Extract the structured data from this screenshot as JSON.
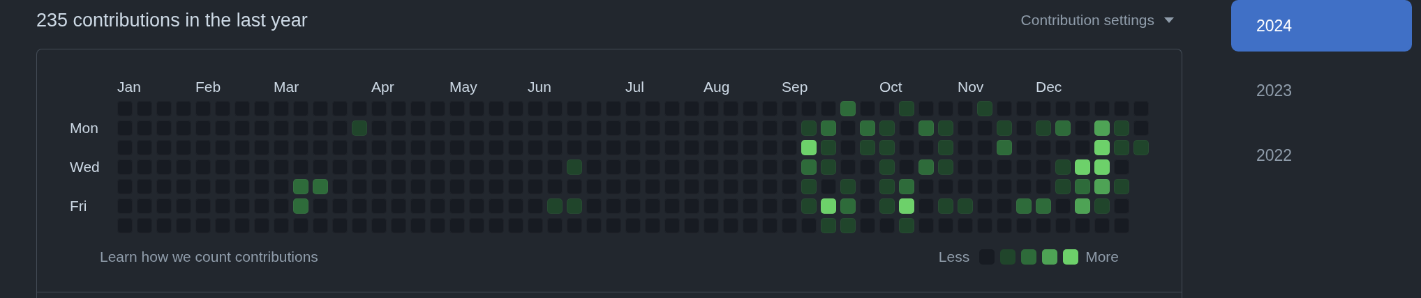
{
  "title": "235 contributions in the last year",
  "settings": {
    "label": "Contribution settings"
  },
  "weekday_labels": [
    "Mon",
    "Wed",
    "Fri"
  ],
  "weeks": [
    {
      "month": "Jan",
      "days": [
        {
          "color": "#171b22"
        },
        {
          "color": "#171b22"
        },
        {
          "color": "#171b22"
        },
        {
          "color": "#171b22"
        },
        {
          "color": "#171b22"
        },
        {
          "color": "#171b22"
        },
        {
          "color": "#171b22"
        }
      ]
    },
    {
      "days": [
        {
          "color": "#171b22"
        },
        {
          "color": "#171b22"
        },
        {
          "color": "#171b22"
        },
        {
          "color": "#171b22"
        },
        {
          "color": "#171b22"
        },
        {
          "color": "#171b22"
        },
        {
          "color": "#171b22"
        }
      ]
    },
    {
      "days": [
        {
          "color": "#171b22"
        },
        {
          "color": "#171b22"
        },
        {
          "color": "#171b22"
        },
        {
          "color": "#171b22"
        },
        {
          "color": "#171b22"
        },
        {
          "color": "#171b22"
        },
        {
          "color": "#171b22"
        }
      ]
    },
    {
      "days": [
        {
          "color": "#171b22"
        },
        {
          "color": "#171b22"
        },
        {
          "color": "#171b22"
        },
        {
          "color": "#171b22"
        },
        {
          "color": "#171b22"
        },
        {
          "color": "#171b22"
        },
        {
          "color": "#171b22"
        }
      ]
    },
    {
      "month": "Feb",
      "days": [
        {
          "color": "#171b22"
        },
        {
          "color": "#171b22"
        },
        {
          "color": "#171b22"
        },
        {
          "color": "#171b22"
        },
        {
          "color": "#171b22"
        },
        {
          "color": "#171b22"
        },
        {
          "color": "#171b22"
        }
      ]
    },
    {
      "days": [
        {
          "color": "#171b22"
        },
        {
          "color": "#171b22"
        },
        {
          "color": "#171b22"
        },
        {
          "color": "#171b22"
        },
        {
          "color": "#171b22"
        },
        {
          "color": "#171b22"
        },
        {
          "color": "#171b22"
        }
      ]
    },
    {
      "days": [
        {
          "color": "#171b22"
        },
        {
          "color": "#171b22"
        },
        {
          "color": "#171b22"
        },
        {
          "color": "#171b22"
        },
        {
          "color": "#171b22"
        },
        {
          "color": "#171b22"
        },
        {
          "color": "#171b22"
        }
      ]
    },
    {
      "days": [
        {
          "color": "#171b22"
        },
        {
          "color": "#171b22"
        },
        {
          "color": "#171b22"
        },
        {
          "color": "#171b22"
        },
        {
          "color": "#171b22"
        },
        {
          "color": "#171b22"
        },
        {
          "color": "#171b22"
        }
      ]
    },
    {
      "month": "Mar",
      "days": [
        {
          "color": "#171b22"
        },
        {
          "color": "#171b22"
        },
        {
          "color": "#171b22"
        },
        {
          "color": "#171b22"
        },
        {
          "color": "#171b22"
        },
        {
          "color": "#171b22"
        },
        {
          "color": "#171b22"
        }
      ]
    },
    {
      "days": [
        {
          "color": "#171b22"
        },
        {
          "color": "#171b22"
        },
        {
          "color": "#171b22"
        },
        {
          "color": "#171b22"
        },
        {
          "color": "#2e6b3a"
        },
        {
          "color": "#2e6b3a"
        },
        {
          "color": "#171b22"
        }
      ]
    },
    {
      "days": [
        {
          "color": "#171b22"
        },
        {
          "color": "#171b22"
        },
        {
          "color": "#171b22"
        },
        {
          "color": "#171b22"
        },
        {
          "color": "#2e6b3a"
        },
        {
          "color": "#171b22"
        },
        {
          "color": "#171b22"
        }
      ]
    },
    {
      "days": [
        {
          "color": "#171b22"
        },
        {
          "color": "#171b22"
        },
        {
          "color": "#171b22"
        },
        {
          "color": "#171b22"
        },
        {
          "color": "#171b22"
        },
        {
          "color": "#171b22"
        },
        {
          "color": "#171b22"
        }
      ]
    },
    {
      "days": [
        {
          "color": "#171b22"
        },
        {
          "color": "#20452b"
        },
        {
          "color": "#171b22"
        },
        {
          "color": "#171b22"
        },
        {
          "color": "#171b22"
        },
        {
          "color": "#171b22"
        },
        {
          "color": "#171b22"
        }
      ]
    },
    {
      "month": "Apr",
      "days": [
        {
          "color": "#171b22"
        },
        {
          "color": "#171b22"
        },
        {
          "color": "#171b22"
        },
        {
          "color": "#171b22"
        },
        {
          "color": "#171b22"
        },
        {
          "color": "#171b22"
        },
        {
          "color": "#171b22"
        }
      ]
    },
    {
      "days": [
        {
          "color": "#171b22"
        },
        {
          "color": "#171b22"
        },
        {
          "color": "#171b22"
        },
        {
          "color": "#171b22"
        },
        {
          "color": "#171b22"
        },
        {
          "color": "#171b22"
        },
        {
          "color": "#171b22"
        }
      ]
    },
    {
      "days": [
        {
          "color": "#171b22"
        },
        {
          "color": "#171b22"
        },
        {
          "color": "#171b22"
        },
        {
          "color": "#171b22"
        },
        {
          "color": "#171b22"
        },
        {
          "color": "#171b22"
        },
        {
          "color": "#171b22"
        }
      ]
    },
    {
      "days": [
        {
          "color": "#171b22"
        },
        {
          "color": "#171b22"
        },
        {
          "color": "#171b22"
        },
        {
          "color": "#171b22"
        },
        {
          "color": "#171b22"
        },
        {
          "color": "#171b22"
        },
        {
          "color": "#171b22"
        }
      ]
    },
    {
      "month": "May",
      "days": [
        {
          "color": "#171b22"
        },
        {
          "color": "#171b22"
        },
        {
          "color": "#171b22"
        },
        {
          "color": "#171b22"
        },
        {
          "color": "#171b22"
        },
        {
          "color": "#171b22"
        },
        {
          "color": "#171b22"
        }
      ]
    },
    {
      "days": [
        {
          "color": "#171b22"
        },
        {
          "color": "#171b22"
        },
        {
          "color": "#171b22"
        },
        {
          "color": "#171b22"
        },
        {
          "color": "#171b22"
        },
        {
          "color": "#171b22"
        },
        {
          "color": "#171b22"
        }
      ]
    },
    {
      "days": [
        {
          "color": "#171b22"
        },
        {
          "color": "#171b22"
        },
        {
          "color": "#171b22"
        },
        {
          "color": "#171b22"
        },
        {
          "color": "#171b22"
        },
        {
          "color": "#171b22"
        },
        {
          "color": "#171b22"
        }
      ]
    },
    {
      "days": [
        {
          "color": "#171b22"
        },
        {
          "color": "#171b22"
        },
        {
          "color": "#171b22"
        },
        {
          "color": "#171b22"
        },
        {
          "color": "#171b22"
        },
        {
          "color": "#171b22"
        },
        {
          "color": "#171b22"
        }
      ]
    },
    {
      "month": "Jun",
      "days": [
        {
          "color": "#171b22"
        },
        {
          "color": "#171b22"
        },
        {
          "color": "#171b22"
        },
        {
          "color": "#171b22"
        },
        {
          "color": "#171b22"
        },
        {
          "color": "#171b22"
        },
        {
          "color": "#171b22"
        }
      ]
    },
    {
      "days": [
        {
          "color": "#171b22"
        },
        {
          "color": "#171b22"
        },
        {
          "color": "#171b22"
        },
        {
          "color": "#171b22"
        },
        {
          "color": "#171b22"
        },
        {
          "color": "#20452b"
        },
        {
          "color": "#171b22"
        }
      ]
    },
    {
      "days": [
        {
          "color": "#171b22"
        },
        {
          "color": "#171b22"
        },
        {
          "color": "#171b22"
        },
        {
          "color": "#20452b"
        },
        {
          "color": "#171b22"
        },
        {
          "color": "#20452b"
        },
        {
          "color": "#171b22"
        }
      ]
    },
    {
      "days": [
        {
          "color": "#171b22"
        },
        {
          "color": "#171b22"
        },
        {
          "color": "#171b22"
        },
        {
          "color": "#171b22"
        },
        {
          "color": "#171b22"
        },
        {
          "color": "#171b22"
        },
        {
          "color": "#171b22"
        }
      ]
    },
    {
      "days": [
        {
          "color": "#171b22"
        },
        {
          "color": "#171b22"
        },
        {
          "color": "#171b22"
        },
        {
          "color": "#171b22"
        },
        {
          "color": "#171b22"
        },
        {
          "color": "#171b22"
        },
        {
          "color": "#171b22"
        }
      ]
    },
    {
      "month": "Jul",
      "days": [
        {
          "color": "#171b22"
        },
        {
          "color": "#171b22"
        },
        {
          "color": "#171b22"
        },
        {
          "color": "#171b22"
        },
        {
          "color": "#171b22"
        },
        {
          "color": "#171b22"
        },
        {
          "color": "#171b22"
        }
      ]
    },
    {
      "days": [
        {
          "color": "#171b22"
        },
        {
          "color": "#171b22"
        },
        {
          "color": "#171b22"
        },
        {
          "color": "#171b22"
        },
        {
          "color": "#171b22"
        },
        {
          "color": "#171b22"
        },
        {
          "color": "#171b22"
        }
      ]
    },
    {
      "days": [
        {
          "color": "#171b22"
        },
        {
          "color": "#171b22"
        },
        {
          "color": "#171b22"
        },
        {
          "color": "#171b22"
        },
        {
          "color": "#171b22"
        },
        {
          "color": "#171b22"
        },
        {
          "color": "#171b22"
        }
      ]
    },
    {
      "days": [
        {
          "color": "#171b22"
        },
        {
          "color": "#171b22"
        },
        {
          "color": "#171b22"
        },
        {
          "color": "#171b22"
        },
        {
          "color": "#171b22"
        },
        {
          "color": "#171b22"
        },
        {
          "color": "#171b22"
        }
      ]
    },
    {
      "month": "Aug",
      "days": [
        {
          "color": "#171b22"
        },
        {
          "color": "#171b22"
        },
        {
          "color": "#171b22"
        },
        {
          "color": "#171b22"
        },
        {
          "color": "#171b22"
        },
        {
          "color": "#171b22"
        },
        {
          "color": "#171b22"
        }
      ]
    },
    {
      "days": [
        {
          "color": "#171b22"
        },
        {
          "color": "#171b22"
        },
        {
          "color": "#171b22"
        },
        {
          "color": "#171b22"
        },
        {
          "color": "#171b22"
        },
        {
          "color": "#171b22"
        },
        {
          "color": "#171b22"
        }
      ]
    },
    {
      "days": [
        {
          "color": "#171b22"
        },
        {
          "color": "#171b22"
        },
        {
          "color": "#171b22"
        },
        {
          "color": "#171b22"
        },
        {
          "color": "#171b22"
        },
        {
          "color": "#171b22"
        },
        {
          "color": "#171b22"
        }
      ]
    },
    {
      "days": [
        {
          "color": "#171b22"
        },
        {
          "color": "#171b22"
        },
        {
          "color": "#171b22"
        },
        {
          "color": "#171b22"
        },
        {
          "color": "#171b22"
        },
        {
          "color": "#171b22"
        },
        {
          "color": "#171b22"
        }
      ]
    },
    {
      "month": "Sep",
      "days": [
        {
          "color": "#171b22"
        },
        {
          "color": "#171b22"
        },
        {
          "color": "#171b22"
        },
        {
          "color": "#171b22"
        },
        {
          "color": "#171b22"
        },
        {
          "color": "#171b22"
        },
        {
          "color": "#171b22"
        }
      ]
    },
    {
      "days": [
        {
          "color": "#171b22"
        },
        {
          "color": "#20452b"
        },
        {
          "color": "#6dd16a"
        },
        {
          "color": "#2e6b3a"
        },
        {
          "color": "#20452b"
        },
        {
          "color": "#20452b"
        },
        {
          "color": "#171b22"
        }
      ]
    },
    {
      "days": [
        {
          "color": "#171b22"
        },
        {
          "color": "#2e6b3a"
        },
        {
          "color": "#20452b"
        },
        {
          "color": "#20452b"
        },
        {
          "color": "#171b22"
        },
        {
          "color": "#6dd16a"
        },
        {
          "color": "#20452b"
        }
      ]
    },
    {
      "days": [
        {
          "color": "#2e6b3a"
        },
        {
          "color": "#171b22"
        },
        {
          "color": "#171b22"
        },
        {
          "color": "#171b22"
        },
        {
          "color": "#20452b"
        },
        {
          "color": "#2e6b3a"
        },
        {
          "color": "#20452b"
        }
      ]
    },
    {
      "days": [
        {
          "color": "#171b22"
        },
        {
          "color": "#2e6b3a"
        },
        {
          "color": "#20452b"
        },
        {
          "color": "#171b22"
        },
        {
          "color": "#171b22"
        },
        {
          "color": "#171b22"
        },
        {
          "color": "#171b22"
        }
      ]
    },
    {
      "month": "Oct",
      "days": [
        {
          "color": "#171b22"
        },
        {
          "color": "#20452b"
        },
        {
          "color": "#20452b"
        },
        {
          "color": "#20452b"
        },
        {
          "color": "#20452b"
        },
        {
          "color": "#20452b"
        },
        {
          "color": "#171b22"
        }
      ]
    },
    {
      "days": [
        {
          "color": "#20452b"
        },
        {
          "color": "#171b22"
        },
        {
          "color": "#171b22"
        },
        {
          "color": "#171b22"
        },
        {
          "color": "#2e6b3a"
        },
        {
          "color": "#6dd16a"
        },
        {
          "color": "#20452b"
        }
      ]
    },
    {
      "days": [
        {
          "color": "#171b22"
        },
        {
          "color": "#2e6b3a"
        },
        {
          "color": "#171b22"
        },
        {
          "color": "#2e6b3a"
        },
        {
          "color": "#171b22"
        },
        {
          "color": "#171b22"
        },
        {
          "color": "#171b22"
        }
      ]
    },
    {
      "days": [
        {
          "color": "#171b22"
        },
        {
          "color": "#20452b"
        },
        {
          "color": "#20452b"
        },
        {
          "color": "#20452b"
        },
        {
          "color": "#171b22"
        },
        {
          "color": "#20452b"
        },
        {
          "color": "#171b22"
        }
      ]
    },
    {
      "month": "Nov",
      "days": [
        {
          "color": "#171b22"
        },
        {
          "color": "#171b22"
        },
        {
          "color": "#171b22"
        },
        {
          "color": "#171b22"
        },
        {
          "color": "#171b22"
        },
        {
          "color": "#20452b"
        },
        {
          "color": "#171b22"
        }
      ]
    },
    {
      "days": [
        {
          "color": "#20452b"
        },
        {
          "color": "#171b22"
        },
        {
          "color": "#171b22"
        },
        {
          "color": "#171b22"
        },
        {
          "color": "#171b22"
        },
        {
          "color": "#171b22"
        },
        {
          "color": "#171b22"
        }
      ]
    },
    {
      "days": [
        {
          "color": "#171b22"
        },
        {
          "color": "#20452b"
        },
        {
          "color": "#2e6b3a"
        },
        {
          "color": "#171b22"
        },
        {
          "color": "#171b22"
        },
        {
          "color": "#171b22"
        },
        {
          "color": "#171b22"
        }
      ]
    },
    {
      "days": [
        {
          "color": "#171b22"
        },
        {
          "color": "#171b22"
        },
        {
          "color": "#171b22"
        },
        {
          "color": "#171b22"
        },
        {
          "color": "#171b22"
        },
        {
          "color": "#2e6b3a"
        },
        {
          "color": "#171b22"
        }
      ]
    },
    {
      "month": "Dec",
      "days": [
        {
          "color": "#171b22"
        },
        {
          "color": "#20452b"
        },
        {
          "color": "#171b22"
        },
        {
          "color": "#171b22"
        },
        {
          "color": "#171b22"
        },
        {
          "color": "#2e6b3a"
        },
        {
          "color": "#171b22"
        }
      ]
    },
    {
      "days": [
        {
          "color": "#171b22"
        },
        {
          "color": "#2e6b3a"
        },
        {
          "color": "#171b22"
        },
        {
          "color": "#20452b"
        },
        {
          "color": "#20452b"
        },
        {
          "color": "#171b22"
        },
        {
          "color": "#171b22"
        }
      ]
    },
    {
      "days": [
        {
          "color": "#171b22"
        },
        {
          "color": "#171b22"
        },
        {
          "color": "#171b22"
        },
        {
          "color": "#6dd16a"
        },
        {
          "color": "#2e6b3a"
        },
        {
          "color": "#4ea355"
        },
        {
          "color": "#171b22"
        }
      ]
    },
    {
      "days": [
        {
          "color": "#171b22"
        },
        {
          "color": "#4ea355"
        },
        {
          "color": "#6dd16a"
        },
        {
          "color": "#6dd16a"
        },
        {
          "color": "#4ea355"
        },
        {
          "color": "#20452b"
        },
        {
          "color": "#171b22"
        }
      ]
    },
    {
      "days": [
        {
          "color": "#171b22"
        },
        {
          "color": "#20452b"
        },
        {
          "color": "#20452b"
        },
        {
          "color": "#171b22"
        },
        {
          "color": "#20452b"
        },
        {
          "color": "#171b22"
        },
        {
          "color": "#171b22"
        }
      ]
    },
    {
      "days": [
        {
          "color": "#171b22"
        },
        {
          "color": "#171b22"
        },
        {
          "color": "#20452b"
        }
      ]
    }
  ],
  "footer": {
    "link": "Learn how we count contributions",
    "less": "Less",
    "more": "More",
    "levels": [
      {
        "color": "#171b22"
      },
      {
        "color": "#20452b"
      },
      {
        "color": "#2e6b3a"
      },
      {
        "color": "#4ea355"
      },
      {
        "color": "#6dd16a"
      }
    ]
  },
  "years": [
    {
      "label": "2024",
      "selected": true
    },
    {
      "label": "2023",
      "selected": false
    },
    {
      "label": "2022",
      "selected": false
    }
  ]
}
